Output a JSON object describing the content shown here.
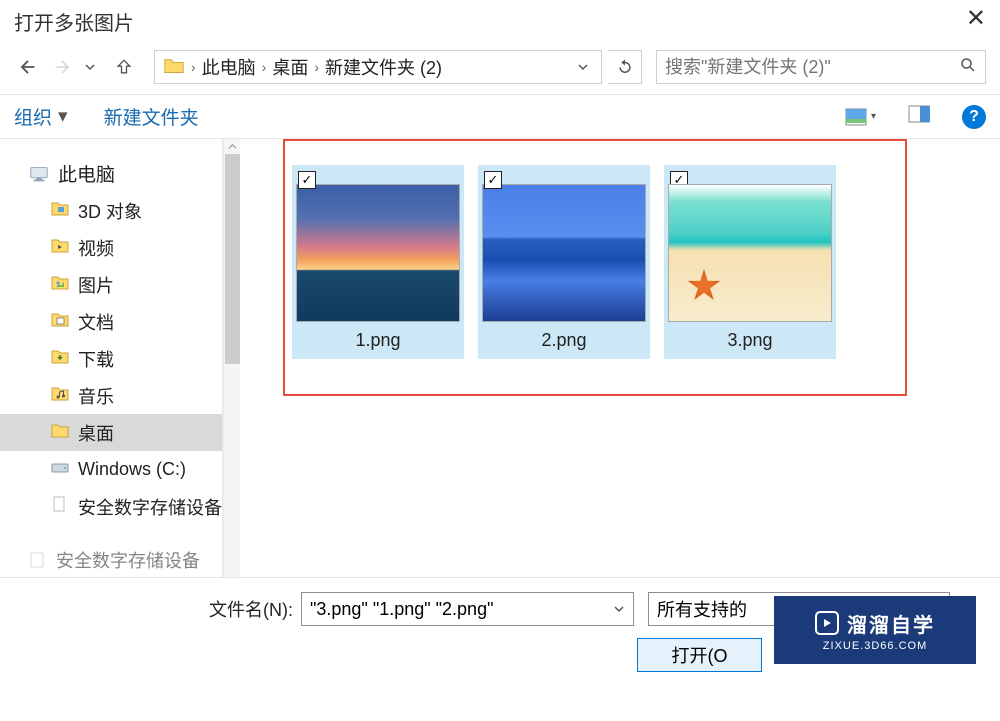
{
  "window": {
    "title": "打开多张图片"
  },
  "breadcrumb": {
    "items": [
      "此电脑",
      "桌面",
      "新建文件夹 (2)"
    ]
  },
  "search": {
    "placeholder": "搜索\"新建文件夹 (2)\""
  },
  "toolbar": {
    "organize": "组织",
    "new_folder": "新建文件夹"
  },
  "sidebar": {
    "root": "此电脑",
    "items": [
      {
        "label": "3D 对象",
        "icon": "folder-3d"
      },
      {
        "label": "视频",
        "icon": "folder-video"
      },
      {
        "label": "图片",
        "icon": "folder-pictures"
      },
      {
        "label": "文档",
        "icon": "folder-docs"
      },
      {
        "label": "下载",
        "icon": "folder-downloads"
      },
      {
        "label": "音乐",
        "icon": "folder-music"
      },
      {
        "label": "桌面",
        "icon": "folder-desktop",
        "selected": true
      },
      {
        "label": "Windows (C:)",
        "icon": "drive"
      },
      {
        "label": "安全数字存储设备",
        "icon": "file"
      }
    ],
    "cutoff_label": "安全数字存储设备"
  },
  "files": [
    {
      "name": "1.png",
      "checked": true,
      "thumb": "sunset"
    },
    {
      "name": "2.png",
      "checked": true,
      "thumb": "ocean"
    },
    {
      "name": "3.png",
      "checked": true,
      "thumb": "beach"
    }
  ],
  "footer": {
    "filename_label": "文件名(N):",
    "filename_value": "\"3.png\" \"1.png\" \"2.png\"",
    "filetype_value": "所有支持的",
    "open_label": "打开(O"
  },
  "watermark": {
    "text": "溜溜自学",
    "sub": "ZIXUE.3D66.COM"
  }
}
